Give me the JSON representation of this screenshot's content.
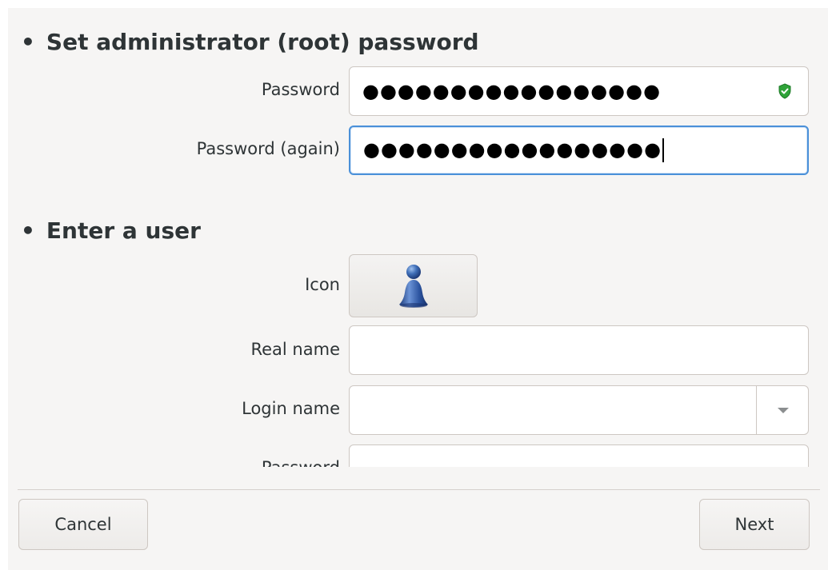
{
  "root_section": {
    "title": "Set administrator (root) password",
    "password_label": "Password",
    "password_value": "●●●●●●●●●●●●●●●●●",
    "password_again_label": "Password (again)",
    "password_again_value": "●●●●●●●●●●●●●●●●●",
    "strength_icon": "green-shield-check-icon",
    "strength_color": "#2fa339"
  },
  "user_section": {
    "title": "Enter a user",
    "icon_label": "Icon",
    "avatar_icon": "user-avatar-icon",
    "real_name_label": "Real name",
    "real_name_value": "",
    "login_name_label": "Login name",
    "login_name_value": "",
    "password_label": "Password",
    "password_value": ""
  },
  "bullet": "•",
  "footer": {
    "cancel_label": "Cancel",
    "next_label": "Next"
  },
  "colors": {
    "focus_border": "#4a90d9",
    "window_bg": "#f6f5f4"
  }
}
